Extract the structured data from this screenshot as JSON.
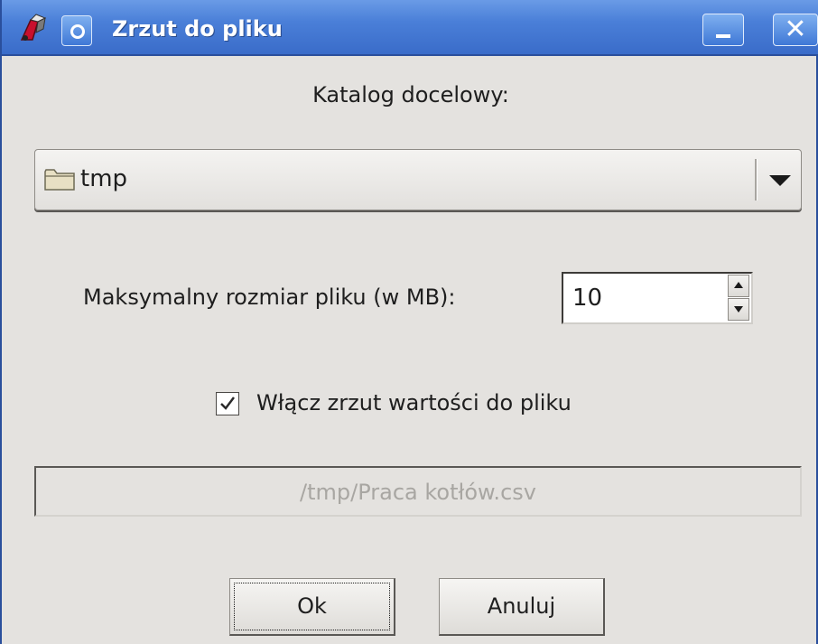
{
  "window": {
    "title": "Zrzut do pliku",
    "icons": {
      "app": "app-logo-icon",
      "menu": "window-menu-icon",
      "minimize": "minimize-icon",
      "close": "close-icon"
    },
    "close_glyph": "✕",
    "accent_color": "#3a6cc9"
  },
  "target_directory": {
    "label": "Katalog docelowy:",
    "selected": "tmp",
    "icon": "folder-icon"
  },
  "max_size": {
    "label": "Maksymalny rozmiar pliku (w MB):",
    "value": "10"
  },
  "dump_toggle": {
    "label": "Włącz zrzut wartości do pliku",
    "checked": true
  },
  "file_path": {
    "value": "/tmp/Praca kotłów.csv"
  },
  "buttons": {
    "ok": "Ok",
    "cancel": "Anuluj"
  }
}
